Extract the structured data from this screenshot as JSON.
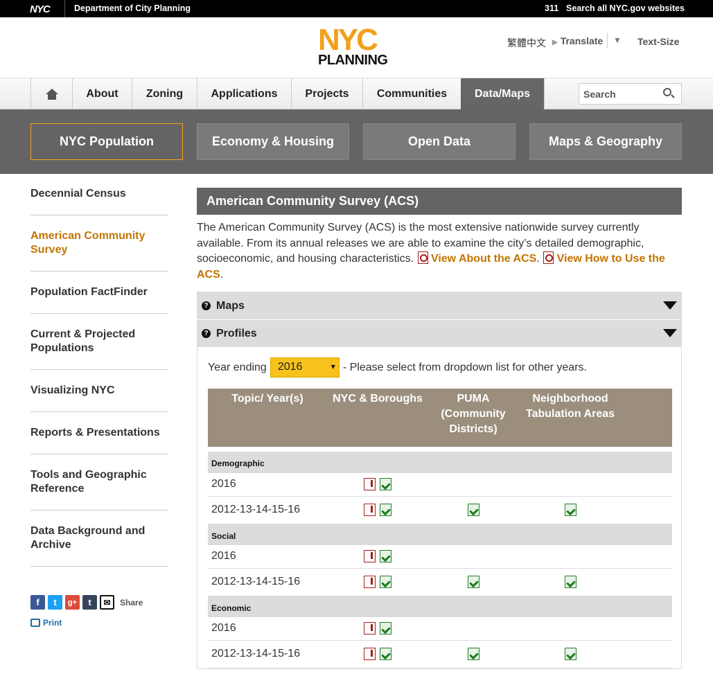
{
  "topbar": {
    "logo": "NYC",
    "department": "Department of City Planning",
    "phone": "311",
    "search_all": "Search all NYC.gov websites"
  },
  "header": {
    "logo_top": "NYC",
    "logo_bottom": "PLANNING",
    "language": "繁體中文",
    "translate": "Translate",
    "text_size": "Text-Size"
  },
  "nav": {
    "items": [
      "About",
      "Zoning",
      "Applications",
      "Projects",
      "Communities",
      "Data/Maps"
    ],
    "active": "Data/Maps",
    "search_placeholder": "Search"
  },
  "subnav": {
    "items": [
      "NYC Population",
      "Economy & Housing",
      "Open Data",
      "Maps & Geography"
    ],
    "active": "NYC Population"
  },
  "sidebar": {
    "items": [
      "Decennial Census",
      "American Community Survey",
      "Population FactFinder",
      "Current & Projected Populations",
      "Visualizing NYC",
      "Reports & Presentations",
      "Tools and Geographic Reference",
      "Data Background and Archive"
    ],
    "active": "American Community Survey",
    "share_label": "Share",
    "print_label": "Print"
  },
  "content": {
    "title": "American Community Survey (ACS)",
    "intro": "The American Community Survey (ACS) is the most extensive nationwide survey currently available. From its annual releases we are able to examine the city’s detailed demographic, socioeconomic, and housing characteristics.",
    "link1": "View About the ACS",
    "link2": "View How to Use the ACS",
    "accordion": {
      "maps": "Maps",
      "profiles": "Profiles"
    },
    "year_label": "Year ending",
    "year_value": "2016",
    "year_hint": "- Please select from dropdown list for other years.",
    "table": {
      "headers": [
        "Topic/ Year(s)",
        "NYC & Boroughs",
        "PUMA (Community Districts)",
        "Neighborhood Tabulation Areas"
      ],
      "sections": [
        {
          "category": "Demographic",
          "rows": [
            "2016",
            "2012-13-14-15-16"
          ]
        },
        {
          "category": "Social",
          "rows": [
            "2016",
            "2012-13-14-15-16"
          ]
        },
        {
          "category": "Economic",
          "rows": [
            "2016",
            "2012-13-14-15-16"
          ]
        }
      ]
    }
  }
}
